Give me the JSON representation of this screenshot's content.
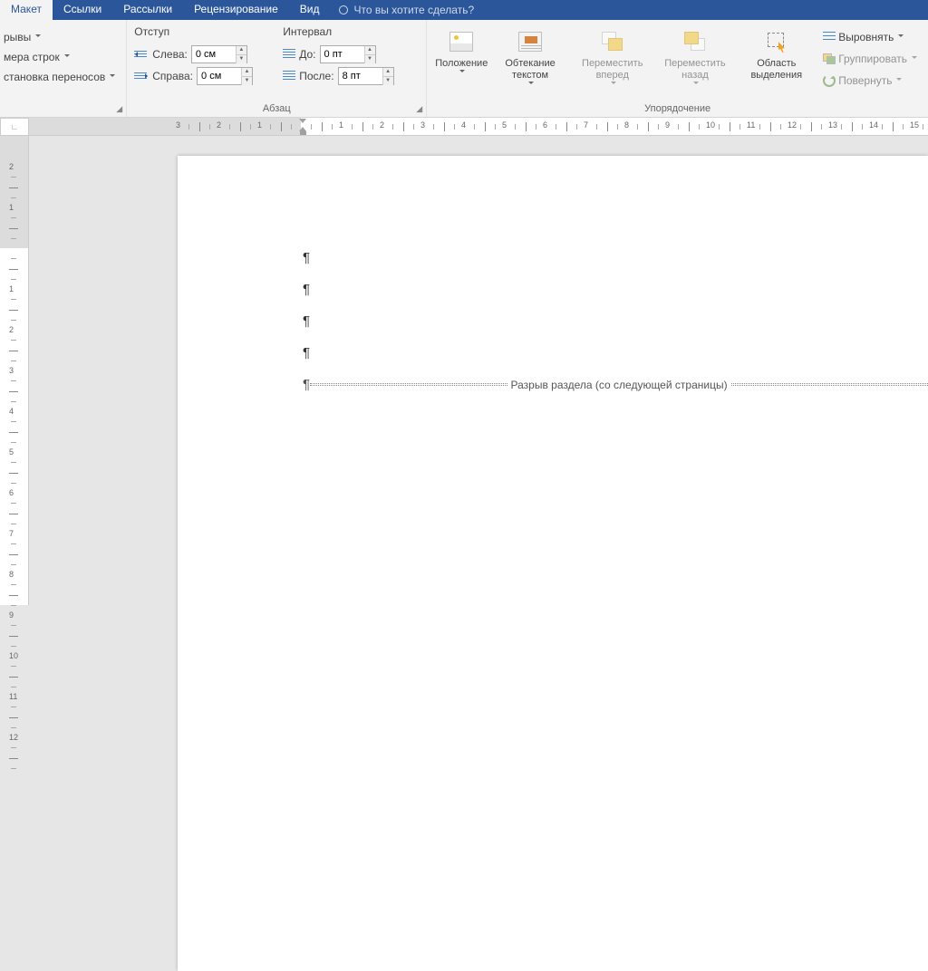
{
  "tabs": {
    "layout": "Макет",
    "links": "Ссылки",
    "mailings": "Рассылки",
    "review": "Рецензирование",
    "view": "Вид",
    "tellme": "Что вы хотите сделать?"
  },
  "page_setup": {
    "breaks": "рывы",
    "line_numbers": "мера строк",
    "hyphenation": "становка переносов"
  },
  "paragraph": {
    "indent_header": "Отступ",
    "spacing_header": "Интервал",
    "left_label": "Слева:",
    "right_label": "Справа:",
    "before_label": "До:",
    "after_label": "После:",
    "left_val": "0 см",
    "right_val": "0 см",
    "before_val": "0 пт",
    "after_val": "8 пт",
    "group_title": "Абзац"
  },
  "arrange": {
    "position": "Положение",
    "wrap": "Обтекание текстом",
    "forward": "Переместить вперед",
    "backward": "Переместить назад",
    "selection": "Область выделения",
    "align": "Выровнять",
    "group": "Группировать",
    "rotate": "Повернуть",
    "group_title": "Упорядочение"
  },
  "document": {
    "section_break": "Разрыв раздела (со следующей страницы)"
  }
}
